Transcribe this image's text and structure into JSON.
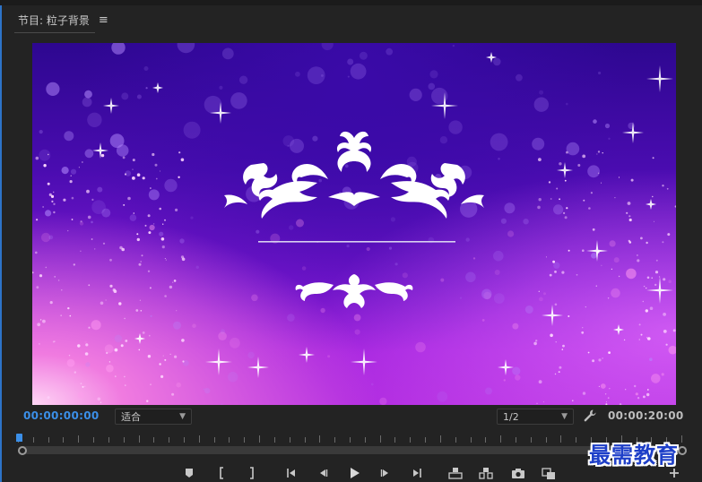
{
  "panel": {
    "title": "节目: 粒子背景",
    "menu_icon": "hamburger-icon",
    "accent_color": "#2d73c8"
  },
  "monitor": {
    "description_colors": {
      "dark": "#2d0790",
      "mid": "#7a16d0",
      "light": "#b02be0",
      "glow": "#f07be0"
    },
    "ornament_color": "#ffffff"
  },
  "controls": {
    "current_timecode": "00:00:00:00",
    "fit_select": {
      "value": "适合"
    },
    "resolution_select": {
      "value": "1/2"
    },
    "settings_icon": "wrench-icon",
    "duration_timecode": "00:00:20:00"
  },
  "transport": {
    "buttons": [
      {
        "name": "add-marker-button",
        "icon": "marker-icon"
      },
      {
        "name": "mark-in-button",
        "icon": "mark-in-icon"
      },
      {
        "name": "mark-out-button",
        "icon": "mark-out-icon"
      },
      {
        "name": "go-to-in-button",
        "icon": "go-to-in-icon"
      },
      {
        "name": "step-back-button",
        "icon": "step-back-icon"
      },
      {
        "name": "play-button",
        "icon": "play-icon"
      },
      {
        "name": "step-forward-button",
        "icon": "step-forward-icon"
      },
      {
        "name": "go-to-out-button",
        "icon": "go-to-out-icon"
      },
      {
        "name": "lift-button",
        "icon": "lift-icon"
      },
      {
        "name": "extract-button",
        "icon": "extract-icon"
      },
      {
        "name": "export-frame-button",
        "icon": "camera-icon"
      },
      {
        "name": "compare-view-button",
        "icon": "compare-icon"
      },
      {
        "name": "button-editor-button",
        "icon": "plus-icon"
      }
    ]
  },
  "watermark": {
    "text": "最需教育",
    "color": "#1e3fc8"
  }
}
